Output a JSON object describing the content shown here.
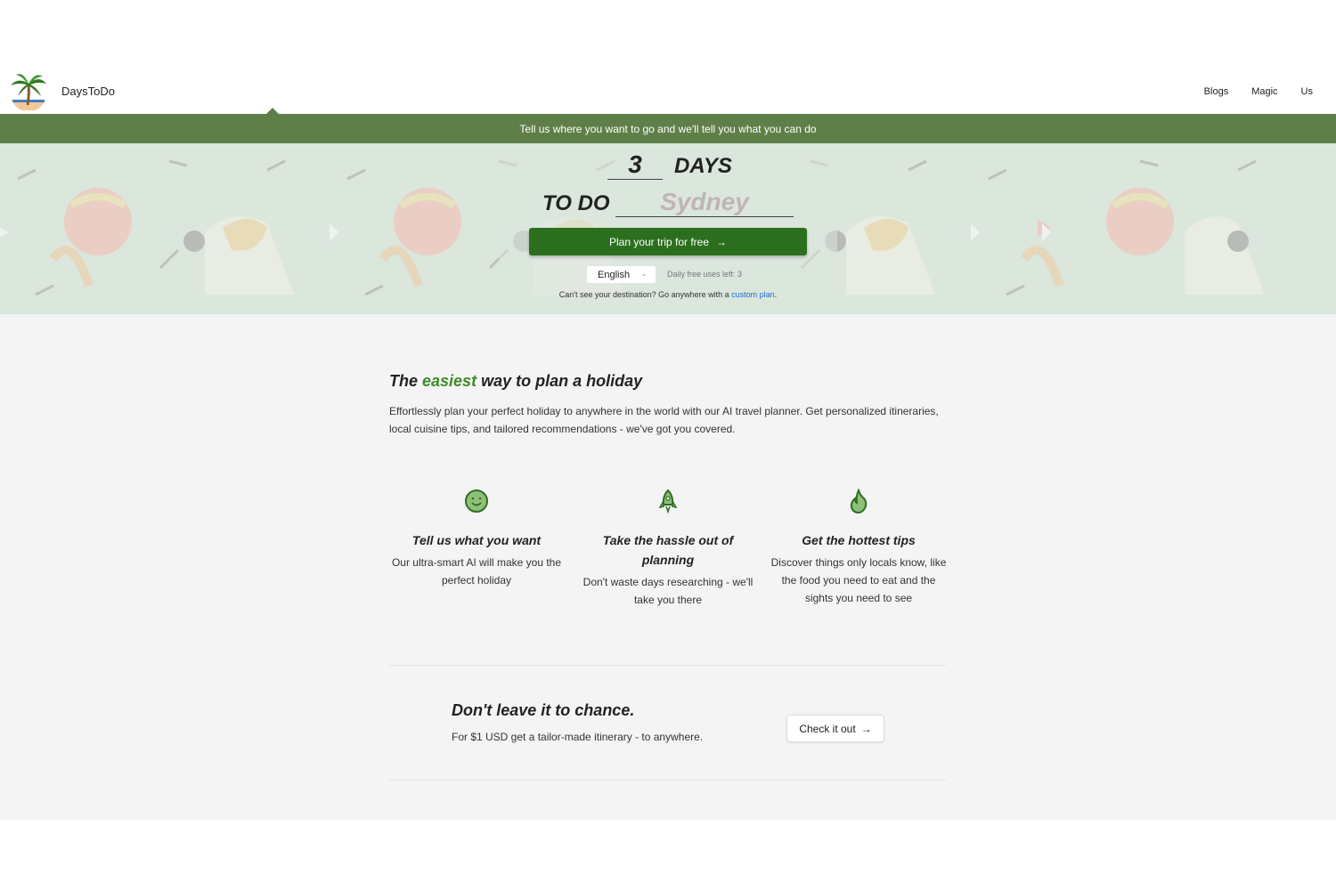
{
  "header": {
    "brand": "DaysToDo",
    "nav": [
      "Blogs",
      "Magic",
      "Us"
    ]
  },
  "banner": {
    "text": "Tell us where you want to go and we'll tell you what you can do"
  },
  "hero": {
    "days_value": "3",
    "days_label": "DAYS",
    "todo_label": "TO DO",
    "destination_placeholder": "Sydney",
    "plan_button": "Plan your trip for free",
    "arrow": "→",
    "language": "English",
    "chevron": "⌄",
    "free_uses": "Daily free uses left: 3",
    "cant_see_prefix": "Can't see your destination? Go anywhere with a ",
    "custom_plan_link": "custom plan",
    "cant_see_suffix": "."
  },
  "intro": {
    "headline_pre": "The ",
    "headline_accent": "easiest",
    "headline_post": " way to plan a holiday",
    "body": "Effortlessly plan your perfect holiday to anywhere in the world with our AI travel planner. Get personalized itineraries, local cuisine tips, and tailored recommendations - we've got you covered.",
    "accent_color": "#3d8a2a"
  },
  "features": [
    {
      "icon": "smiley-icon",
      "title": "Tell us what you want",
      "text": "Our ultra-smart AI will make you the perfect holiday"
    },
    {
      "icon": "rocket-icon",
      "title": "Take the hassle out of planning",
      "text": "Don't waste days researching - we'll take you there"
    },
    {
      "icon": "fire-icon",
      "title": "Get the hottest tips",
      "text": "Discover things only locals know, like the food you need to eat and the sights you need to see"
    }
  ],
  "cta": {
    "title": "Don't leave it to chance.",
    "text": "For $1 USD get a tailor-made itinerary - to anywhere.",
    "button": "Check it out",
    "arrow": "→"
  },
  "colors": {
    "banner": "#5f7f48",
    "primary_button": "#2b6f1e",
    "hero_bg": "#dbe6dc",
    "link": "#1a6fd1"
  }
}
